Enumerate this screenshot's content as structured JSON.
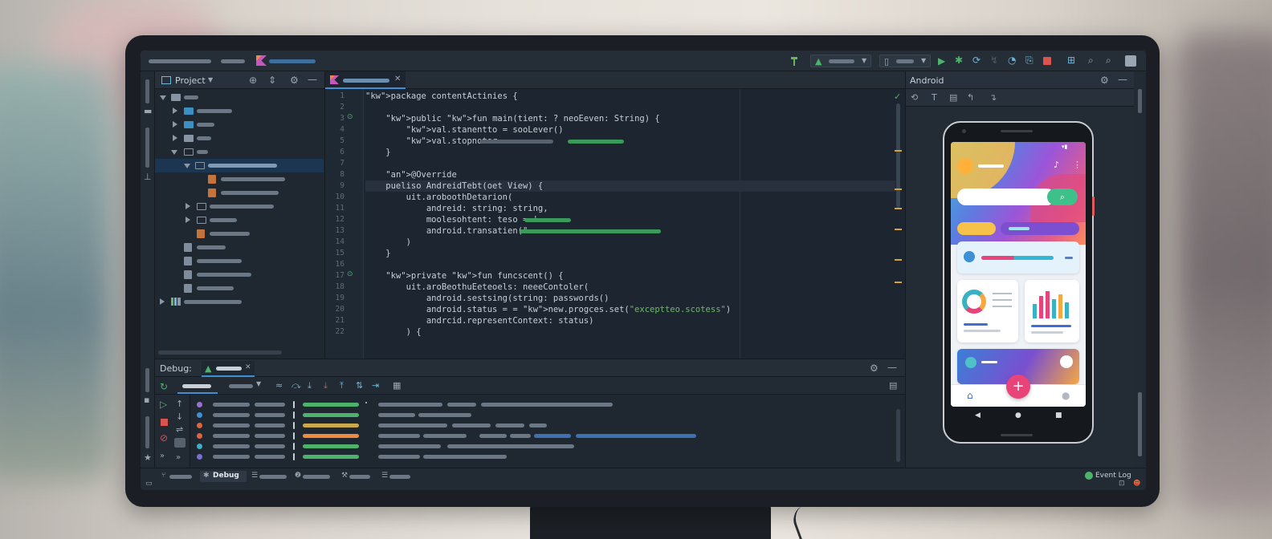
{
  "project_panel": {
    "title": "Project"
  },
  "editor": {
    "lines": [
      {
        "n": "1",
        "code": "package contentActinies {"
      },
      {
        "n": "2",
        "code": ""
      },
      {
        "n": "3",
        "code": "    public fun main(tient: ? neoEeven: String) {"
      },
      {
        "n": "4",
        "code": "        val.stanentto = sooLever()"
      },
      {
        "n": "5",
        "code": "        val.stopnotor = "
      },
      {
        "n": "6",
        "code": "    }"
      },
      {
        "n": "7",
        "code": ""
      },
      {
        "n": "8",
        "code": "    @Override"
      },
      {
        "n": "9",
        "code": "    pueliso AndreidTebt(oet View) {"
      },
      {
        "n": "10",
        "code": "        uit.aroboothDetarion("
      },
      {
        "n": "11",
        "code": "            andreid: string: string,"
      },
      {
        "n": "12",
        "code": "            moolesohtent: teso = '"
      },
      {
        "n": "13",
        "code": "            android.transatien(\""
      },
      {
        "n": "14",
        "code": "        )"
      },
      {
        "n": "15",
        "code": "    }"
      },
      {
        "n": "16",
        "code": ""
      },
      {
        "n": "17",
        "code": "    private fun funcscent() {"
      },
      {
        "n": "18",
        "code": "        uit.aroBeothuEeteoels: neeeContoler("
      },
      {
        "n": "19",
        "code": "            android.sestsing(string: passwords()"
      },
      {
        "n": "20",
        "code": "            android.status = = new.progces.set(\"exceptteo.scotess\")"
      },
      {
        "n": "21",
        "code": "            andrcid.representContext: status)"
      },
      {
        "n": "22",
        "code": "        ) {"
      }
    ]
  },
  "android_panel": {
    "title": "Android"
  },
  "debug_panel": {
    "title": "Debug:"
  },
  "statusbar": {
    "debug_tab": "Debug",
    "event_log": "Event Log"
  },
  "colors": {
    "accent_blue": "#3d8fd6",
    "run_green": "#4db36b",
    "stop_red": "#d9534f",
    "warning_yellow": "#d3a341"
  }
}
